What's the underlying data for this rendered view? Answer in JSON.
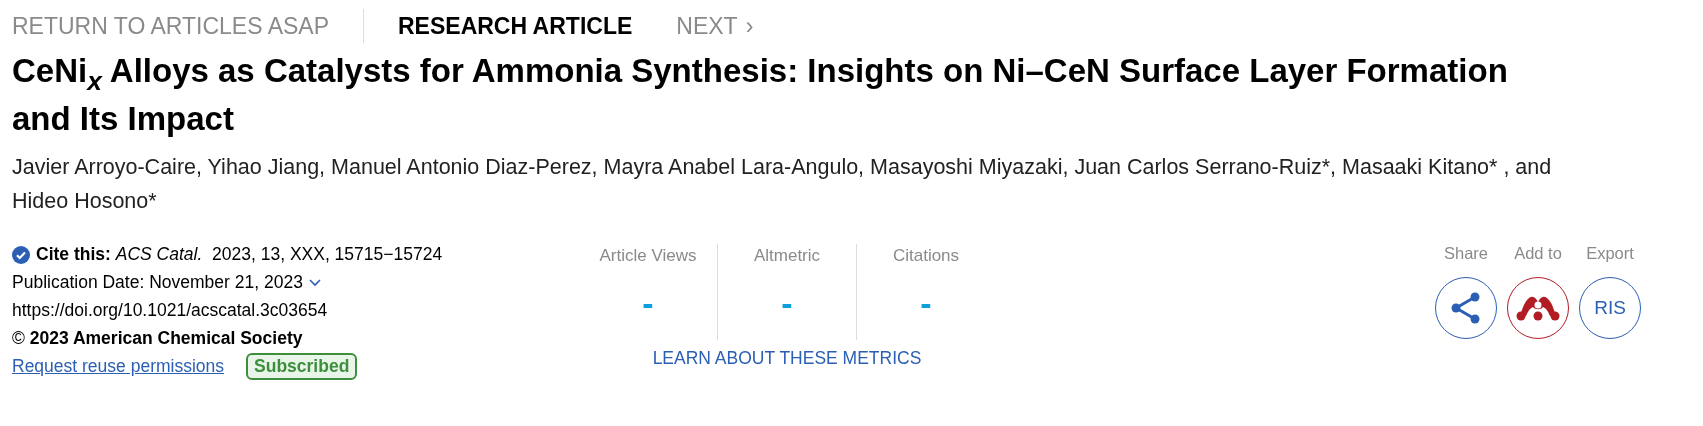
{
  "nav": {
    "back": "RETURN TO ARTICLES ASAP",
    "type": "RESEARCH ARTICLE",
    "next": "NEXT",
    "next_icon": "›"
  },
  "title": "CeNi$_{x}$ Alloys as Catalysts for Ammonia Synthesis: Insights on Ni–CeN Surface Layer Formation and Its Impact",
  "authors": "Javier Arroyo-Caire, Yihao Jiang, Manuel Antonio Diaz-Perez, Mayra Anabel Lara-Angulo, Masayoshi Miyazaki, Juan Carlos Serrano-Ruiz*, Masaaki Kitano* , and Hideo Hosono*",
  "citation": {
    "cite": "**Cite this:** *ACS Catal.*  2023, 13, XXX, 15715−15724",
    "publication_date": "Publication Date: November 21, 2023",
    "doi": "https://doi.org/10.1021/acscatal.3c03654",
    "copyright": "© **2023 American Chemical Society**",
    "reuse_link": "Request reuse permissions",
    "badge": "Subscribed"
  },
  "metrics": [
    {
      "label": "Article Views",
      "value": "-"
    },
    {
      "label": "Altmetric",
      "value": "-"
    },
    {
      "label": "Citations",
      "value": "-"
    }
  ],
  "metrics_link": "LEARN ABOUT THESE METRICS",
  "actions": [
    {
      "label": "Share",
      "kind": "share"
    },
    {
      "label": "Add to",
      "kind": "mendeley"
    },
    {
      "label": "Export",
      "kind": "text",
      "text": "RIS"
    }
  ]
}
